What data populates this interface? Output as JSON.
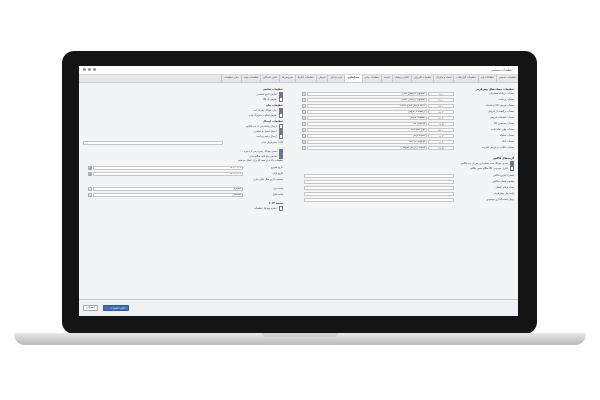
{
  "window": {
    "title": "تنظیمات سیستم"
  },
  "tabs": [
    {
      "label": "تنظیمات عمومی"
    },
    {
      "label": "اطلاعات پایه"
    },
    {
      "label": "تنظیمات گزارشات"
    },
    {
      "label": "اسناد و مدارک"
    },
    {
      "label": "تنظیمات کاربران"
    },
    {
      "label": "اعلان و پیامک"
    },
    {
      "label": "امنیت"
    },
    {
      "label": "تنظیمات چاپ"
    },
    {
      "label": "حسابداری"
    },
    {
      "label": "خرید و انبار"
    },
    {
      "label": "فروش"
    },
    {
      "label": "تنظیمات انبارها"
    },
    {
      "label": "سرویس‌ها"
    },
    {
      "label": "تامین کنندگان"
    },
    {
      "label": "تنظیمات تولید"
    },
    {
      "label": "سایر تنظیمات"
    }
  ],
  "right_panel": {
    "header": "تنظیمات حساب‌های پیش‌فرض",
    "rows": [
      {
        "label": "حساب دریافت مشتریان",
        "code": "۱۱۰۱",
        "value": "حسابهای دریافتنی تجاری"
      },
      {
        "label": "حساب پرداخت",
        "code": "۲۱۰۱",
        "value": "حسابهای پرداختنی تجاری"
      },
      {
        "label": "حساب فروش کالا و خدمات",
        "code": "۴۱۰۱",
        "value": "درآمد فروش کالا و خدمات"
      },
      {
        "label": "حساب برگشت از فروش",
        "code": "۴۱۰۲",
        "value": "برگشت از فروش"
      },
      {
        "label": "حساب تخفیفات فروش",
        "code": "۴۱۰۳",
        "value": "تخفیفات فروش"
      },
      {
        "label": "حساب موجودی کالا",
        "code": "۱۱۰۵",
        "value": "موجودی کالا"
      },
      {
        "label": "حساب بهای تمام شده",
        "code": "۵۱۰۱",
        "value": "بهای تمام شده"
      },
      {
        "label": "حساب تنخواه",
        "code": "۱۱۰۳",
        "value": "تنخواه گردان"
      },
      {
        "label": "حساب بانک",
        "code": "۱۱۰۲",
        "value": "موجودی نزد بانک"
      },
      {
        "label": "حساب مالیات بر ارزش افزوده",
        "code": "۲۱۰۵",
        "value": "مالیات بر ارزش افزوده"
      }
    ],
    "section2_title": "گزینه‌های فاکتور",
    "section2_checks": [
      {
        "label": "صدور خودکار سند حسابداری پس از ثبت فاکتور",
        "on": true
      },
      {
        "label": "کنترل موجودی کالا هنگام صدور فاکتور",
        "on": false
      }
    ],
    "section2_fields": [
      {
        "label": "شماره شروع فاکتور"
      },
      {
        "label": "پیشوند شماره فاکتور"
      },
      {
        "label": "تعداد ارقام اعشار"
      },
      {
        "label": "واحد پول پیش‌فرض"
      },
      {
        "label": "روش قیمت‌گذاری موجودی"
      }
    ]
  },
  "left_panel": {
    "section1_title": "تنظیمات نمایش",
    "section1_checks": [
      {
        "label": "نمایش تاریخ شمسی",
        "on": true
      },
      {
        "label": "نمایش کد کالا",
        "on": false
      }
    ],
    "section2_title": "تنظیمات چاپ",
    "section2_checks": [
      {
        "label": "چاپ خودکار پس از ثبت",
        "on": true
      },
      {
        "label": "نمایش لوگو در سربرگ چاپ",
        "on": false
      }
    ],
    "section3_title": "تنظیمات ارسال",
    "section3_checks": [
      {
        "label": "ارسال پیامک پس از ثبت فاکتور",
        "on": false
      },
      {
        "label": "ارسال ایمیل به مشتری",
        "on": true
      },
      {
        "label": "ارسال رسید پرداخت",
        "on": false
      }
    ],
    "select_label": "قالب پیش‌فرض چاپ",
    "section4_checks": [
      {
        "label": "بستن خودکار پنجره پس از ذخیره",
        "on": true
      },
      {
        "label": "نمایش پیام تایید هنگام حذف",
        "on": true
      }
    ],
    "note": "تنظیمات بالا برای همه کاربران اعمال می‌شود",
    "date_label": "تاریخ شروع",
    "date_value": "۱۴۰۲/۰۱/۰۱",
    "date2_label": "تاریخ پایان",
    "date2_value": "۱۴۰۲/۱۲/۲۹",
    "date_note": "محدوده تاریخ سال مالی جاری",
    "unit_label": "واحد وزن",
    "unit_value": "کیلوگرم",
    "unit2_label": "واحد طول",
    "unit2_value": "سانتیمتر",
    "footer_check_title": "نسخه ۲۰۲۳",
    "footer_check": "ذخیره خودکار تنظیمات"
  },
  "statusbar": {
    "save_label": "ذخیره تغییرات",
    "cancel_label": "انصراف"
  },
  "colors": {
    "accent": "#3f6fb8"
  }
}
